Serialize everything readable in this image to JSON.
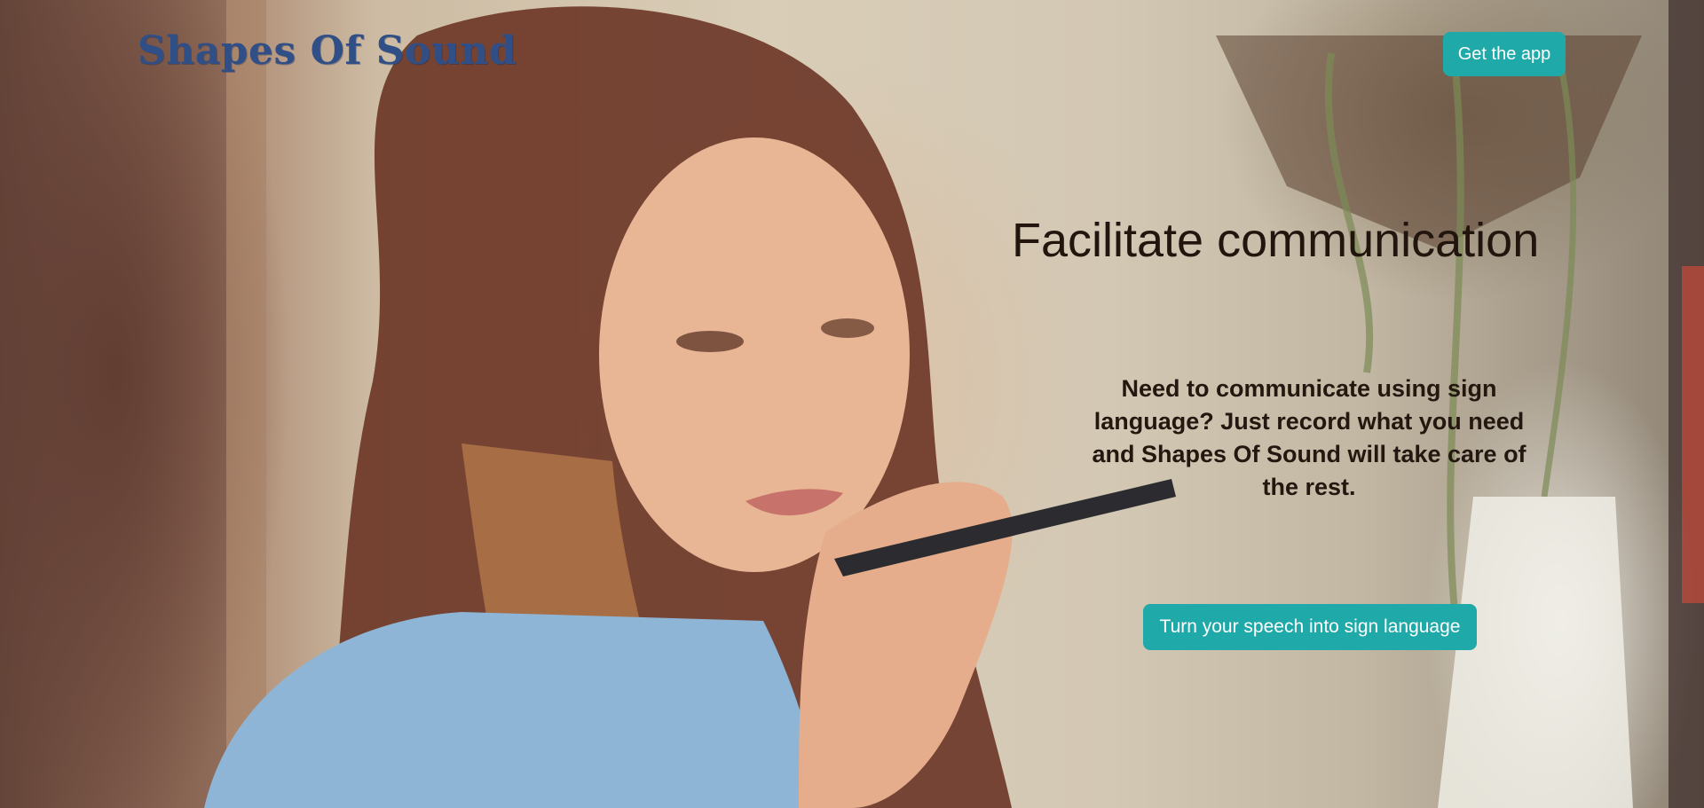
{
  "header": {
    "logo_text": "Shapes Of Sound",
    "get_app_label": "Get the app"
  },
  "hero": {
    "title": "Facilitate communication",
    "description": "Need to communicate using sign language? Just record what you need and Shapes Of Sound will take care of the rest.",
    "cta_label": "Turn your speech into sign language",
    "image_subject": "woman-speaking-into-phone"
  },
  "colors": {
    "accent": "#1fa9a8",
    "logo": "#2f4f86",
    "heading_text": "#21150d"
  }
}
